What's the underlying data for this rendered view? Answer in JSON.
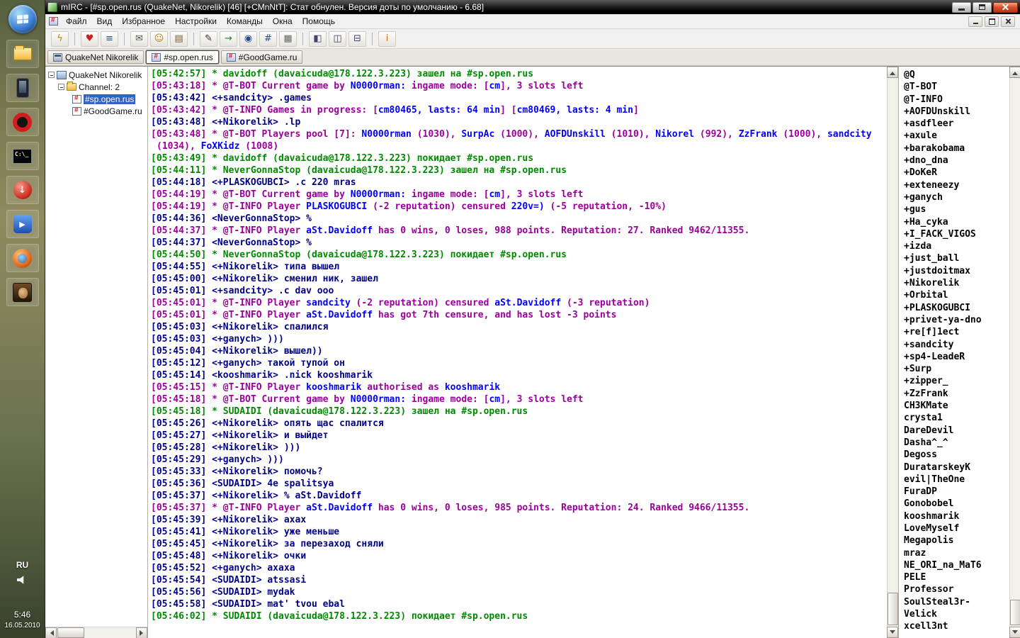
{
  "colors": {
    "g": "#008a00",
    "p": "#9c009c",
    "n": "#000087",
    "b": "#0000fc",
    "k": "#000000"
  },
  "taskbar": {
    "language": "RU",
    "time": "5:46",
    "date": "16.05.2010",
    "icons": [
      "explorer",
      "device",
      "opera",
      "command-prompt",
      "download-manager",
      "media-player",
      "browser",
      "game"
    ]
  },
  "window": {
    "title": "mIRC - [#sp.open.rus (QuakeNet, Nikorelik) [46] [+CMnNtT]: Стат обнулен. Версия доты по умолчанию - 6.68]"
  },
  "menu": [
    "Файл",
    "Вид",
    "Избранное",
    "Настройки",
    "Команды",
    "Окна",
    "Помощь"
  ],
  "toolbar": [
    {
      "n": "connect",
      "g": "ϟ",
      "c": "#b8860b"
    },
    "|",
    {
      "n": "favorites",
      "g": "♥",
      "c": "#cc2020"
    },
    {
      "n": "channels-list",
      "g": "≡",
      "c": "#34518c"
    },
    "|",
    {
      "n": "query-window",
      "g": "✉",
      "c": "#555555"
    },
    {
      "n": "notify-list",
      "g": "☺",
      "c": "#b8860b"
    },
    {
      "n": "address-book",
      "g": "▤",
      "c": "#7a5c2e"
    },
    "|",
    {
      "n": "scripts-editor",
      "g": "✎",
      "c": "#333333"
    },
    {
      "n": "dcc-send",
      "g": "→",
      "c": "#2a7a2a"
    },
    {
      "n": "dcc-chat",
      "g": "◉",
      "c": "#2a4b8a"
    },
    {
      "n": "url-list",
      "g": "#",
      "c": "#2a4b8a"
    },
    {
      "n": "notes",
      "g": "▦",
      "c": "#666666"
    },
    "|",
    {
      "n": "cascade-windows",
      "g": "◧",
      "c": "#44446a"
    },
    {
      "n": "tile-windows-horizontally",
      "g": "◫",
      "c": "#44446a"
    },
    {
      "n": "tile-windows-vertically",
      "g": "⊟",
      "c": "#44446a"
    },
    "|",
    {
      "n": "help",
      "g": "i",
      "c": "#d07010"
    }
  ],
  "switchbar": {
    "tabs": [
      {
        "label": "QuakeNet Nikorelik",
        "type": "status",
        "active": false
      },
      {
        "label": "#sp.open.rus",
        "type": "channel",
        "active": true
      },
      {
        "label": "#GoodGame.ru",
        "type": "channel",
        "active": false
      }
    ]
  },
  "tree": {
    "network": "QuakeNet Nikorelik",
    "folder": "Channel: 2",
    "channels": [
      {
        "name": "#sp.open.rus",
        "selected": true
      },
      {
        "name": "#GoodGame.ru",
        "selected": false
      }
    ]
  },
  "chat": {
    "messages": [
      {
        "t": "05:42:57",
        "c": "g",
        "s": [
          "* davidoff (davaicuda@178.122.3.223) зашел на #sp.open.rus"
        ]
      },
      {
        "t": "05:43:18",
        "c": "p",
        "s": [
          "* @T-BOT Current game by ",
          [
            "N0000rman:",
            "b"
          ],
          " ingame mode: [",
          [
            "cm",
            "b"
          ],
          "], 3 slots left"
        ]
      },
      {
        "t": "05:43:42",
        "c": "n",
        "s": [
          "<+sandcity> .games"
        ]
      },
      {
        "t": "05:43:42",
        "c": "p",
        "s": [
          "* @T-INFO Games in progress: [",
          [
            "cm80465, lasts: 64 min",
            "b"
          ],
          "] [",
          [
            "cm80469, lasts: 4 min",
            "b"
          ],
          "]"
        ]
      },
      {
        "t": "05:43:48",
        "c": "n",
        "s": [
          "<+Nikorelik> .lp"
        ]
      },
      {
        "t": "05:43:48",
        "c": "p",
        "s": [
          "* @T-BOT Players pool [7]: ",
          [
            "N0000rman",
            "b"
          ],
          " (1030), ",
          [
            "SurpAc",
            "b"
          ],
          " (1000), ",
          [
            "AOFDUnskill",
            "b"
          ],
          " (1010), ",
          [
            "Nikorel",
            "b"
          ],
          " (992), ",
          [
            "ZzFrank",
            "b"
          ],
          " (1000), ",
          [
            "sandcity",
            "b"
          ],
          " (1034), ",
          [
            "FoXKidz",
            "b"
          ],
          " (1008)"
        ]
      },
      {
        "t": "05:43:49",
        "c": "g",
        "s": [
          "* davidoff (davaicuda@178.122.3.223) покидает #sp.open.rus"
        ]
      },
      {
        "t": "05:44:11",
        "c": "g",
        "s": [
          "* NeverGonnaStop (davaicuda@178.122.3.223) зашел на #sp.open.rus"
        ]
      },
      {
        "t": "05:44:18",
        "c": "n",
        "s": [
          "<+PLASKOGUBCI> .c 220 mras"
        ]
      },
      {
        "t": "05:44:19",
        "c": "p",
        "s": [
          "* @T-BOT Current game by ",
          [
            "N0000rman:",
            "b"
          ],
          " ingame mode: [",
          [
            "cm",
            "b"
          ],
          "], 3 slots left"
        ]
      },
      {
        "t": "05:44:19",
        "c": "p",
        "s": [
          "* @T-INFO Player ",
          [
            "PLASKOGUBCI",
            "b"
          ],
          " (-2 reputation) censured ",
          [
            "220v=)",
            "b"
          ],
          " (-5 reputation, -10%)"
        ]
      },
      {
        "t": "05:44:36",
        "c": "n",
        "s": [
          "<NeverGonnaStop> %"
        ]
      },
      {
        "t": "05:44:37",
        "c": "p",
        "s": [
          "* @T-INFO Player ",
          [
            "aSt.Davidoff",
            "b"
          ],
          " has 0 wins, 0 loses, 988 points. Reputation: 27. Ranked 9462/11355."
        ]
      },
      {
        "t": "05:44:37",
        "c": "n",
        "s": [
          "<NeverGonnaStop> %"
        ]
      },
      {
        "t": "05:44:50",
        "c": "g",
        "s": [
          "* NeverGonnaStop (davaicuda@178.122.3.223) покидает #sp.open.rus"
        ]
      },
      {
        "t": "05:44:55",
        "c": "n",
        "s": [
          "<+Nikorelik> типа вышел"
        ]
      },
      {
        "t": "05:45:00",
        "c": "n",
        "s": [
          "<+Nikorelik> сменил ник, зашел"
        ]
      },
      {
        "t": "05:45:01",
        "c": "n",
        "s": [
          "<+sandcity> .c dav ooo"
        ]
      },
      {
        "t": "05:45:01",
        "c": "p",
        "s": [
          "* @T-INFO Player ",
          [
            "sandcity",
            "b"
          ],
          " (-2 reputation) censured ",
          [
            "aSt.Davidoff",
            "b"
          ],
          " (-3 reputation)"
        ]
      },
      {
        "t": "05:45:01",
        "c": "p",
        "s": [
          "* @T-INFO Player ",
          [
            "aSt.Davidoff",
            "b"
          ],
          " has got 7th censure, and has lost -3 points"
        ]
      },
      {
        "t": "05:45:03",
        "c": "n",
        "s": [
          "<+Nikorelik> спалился"
        ]
      },
      {
        "t": "05:45:03",
        "c": "n",
        "s": [
          "<+ganych> )))"
        ]
      },
      {
        "t": "05:45:04",
        "c": "n",
        "s": [
          "<+Nikorelik> вышел))"
        ]
      },
      {
        "t": "05:45:12",
        "c": "n",
        "s": [
          "<+ganych> такой тупой он"
        ]
      },
      {
        "t": "05:45:14",
        "c": "n",
        "s": [
          "<kooshmarik> .nick kooshmarik"
        ]
      },
      {
        "t": "05:45:15",
        "c": "p",
        "s": [
          "* @T-INFO Player ",
          [
            "kooshmarik",
            "b"
          ],
          " authorised as ",
          [
            "kooshmarik",
            "b"
          ]
        ]
      },
      {
        "t": "05:45:18",
        "c": "p",
        "s": [
          "* @T-BOT Current game by ",
          [
            "N0000rman:",
            "b"
          ],
          " ingame mode: [",
          [
            "cm",
            "b"
          ],
          "], 3 slots left"
        ]
      },
      {
        "t": "05:45:18",
        "c": "g",
        "s": [
          "* SUDAIDI (davaicuda@178.122.3.223) зашел на #sp.open.rus"
        ]
      },
      {
        "t": "05:45:26",
        "c": "n",
        "s": [
          "<+Nikorelik> опять щас спалится"
        ]
      },
      {
        "t": "05:45:27",
        "c": "n",
        "s": [
          "<+Nikorelik> и выйдет"
        ]
      },
      {
        "t": "05:45:28",
        "c": "n",
        "s": [
          "<+Nikorelik> )))"
        ]
      },
      {
        "t": "05:45:29",
        "c": "n",
        "s": [
          "<+ganych> )))"
        ]
      },
      {
        "t": "05:45:33",
        "c": "n",
        "s": [
          "<+Nikorelik> помочь?"
        ]
      },
      {
        "t": "05:45:36",
        "c": "n",
        "s": [
          "<SUDAIDI> 4e spalitsya"
        ]
      },
      {
        "t": "05:45:37",
        "c": "n",
        "s": [
          "<+Nikorelik> % aSt.Davidoff"
        ]
      },
      {
        "t": "05:45:37",
        "c": "p",
        "s": [
          "* @T-INFO Player ",
          [
            "aSt.Davidoff",
            "b"
          ],
          " has 0 wins, 0 loses, 985 points. Reputation: 24. Ranked 9466/11355."
        ]
      },
      {
        "t": "05:45:39",
        "c": "n",
        "s": [
          "<+Nikorelik> ахах"
        ]
      },
      {
        "t": "05:45:41",
        "c": "n",
        "s": [
          "<+Nikorelik> уже меньше"
        ]
      },
      {
        "t": "05:45:45",
        "c": "n",
        "s": [
          "<+Nikorelik> за перезаход сняли"
        ]
      },
      {
        "t": "05:45:48",
        "c": "n",
        "s": [
          "<+Nikorelik> очки"
        ]
      },
      {
        "t": "05:45:52",
        "c": "n",
        "s": [
          "<+ganych> ахаха"
        ]
      },
      {
        "t": "05:45:54",
        "c": "n",
        "s": [
          "<SUDAIDI> atssasi"
        ]
      },
      {
        "t": "05:45:56",
        "c": "n",
        "s": [
          "<SUDAIDI> mydak"
        ]
      },
      {
        "t": "05:45:58",
        "c": "n",
        "s": [
          "<SUDAIDI> mat' tvou ebal"
        ]
      },
      {
        "t": "05:46:02",
        "c": "g",
        "s": [
          "* SUDAIDI (davaicuda@178.122.3.223) покидает #sp.open.rus"
        ]
      }
    ]
  },
  "nicklist": [
    "@Q",
    "@T-BOT",
    "@T-INFO",
    "+AOFDUnskill",
    "+asdfleer",
    "+axule",
    "+barakobama",
    "+dno_dna",
    "+DoKeR",
    "+exteneezy",
    "+ganych",
    "+gus",
    "+Ha_cyka",
    "+I_FACK_VIGOS",
    "+izda",
    "+just_ball",
    "+justdoitmax",
    "+Nikorelik",
    "+Orbital",
    "+PLASKOGUBCI",
    "+privet-ya-dno",
    "+re[f]1ect",
    "+sandcity",
    "+sp4-LeadeR",
    "+Surp",
    "+zipper_",
    "+ZzFrank",
    "CH3KMate",
    "crysta1",
    "DareDevil",
    "Dasha^_^",
    "Degoss",
    "DuratarskeyK",
    "evil|TheOne",
    "FuraDP",
    "Gonobobel",
    "kooshmarik",
    "LoveMyself",
    "Megapolis",
    "mraz",
    "NE_ORI_na_MaT6",
    "PELE",
    "Professor",
    "SoulSteal3r-",
    "Velick",
    "xcell3nt"
  ]
}
